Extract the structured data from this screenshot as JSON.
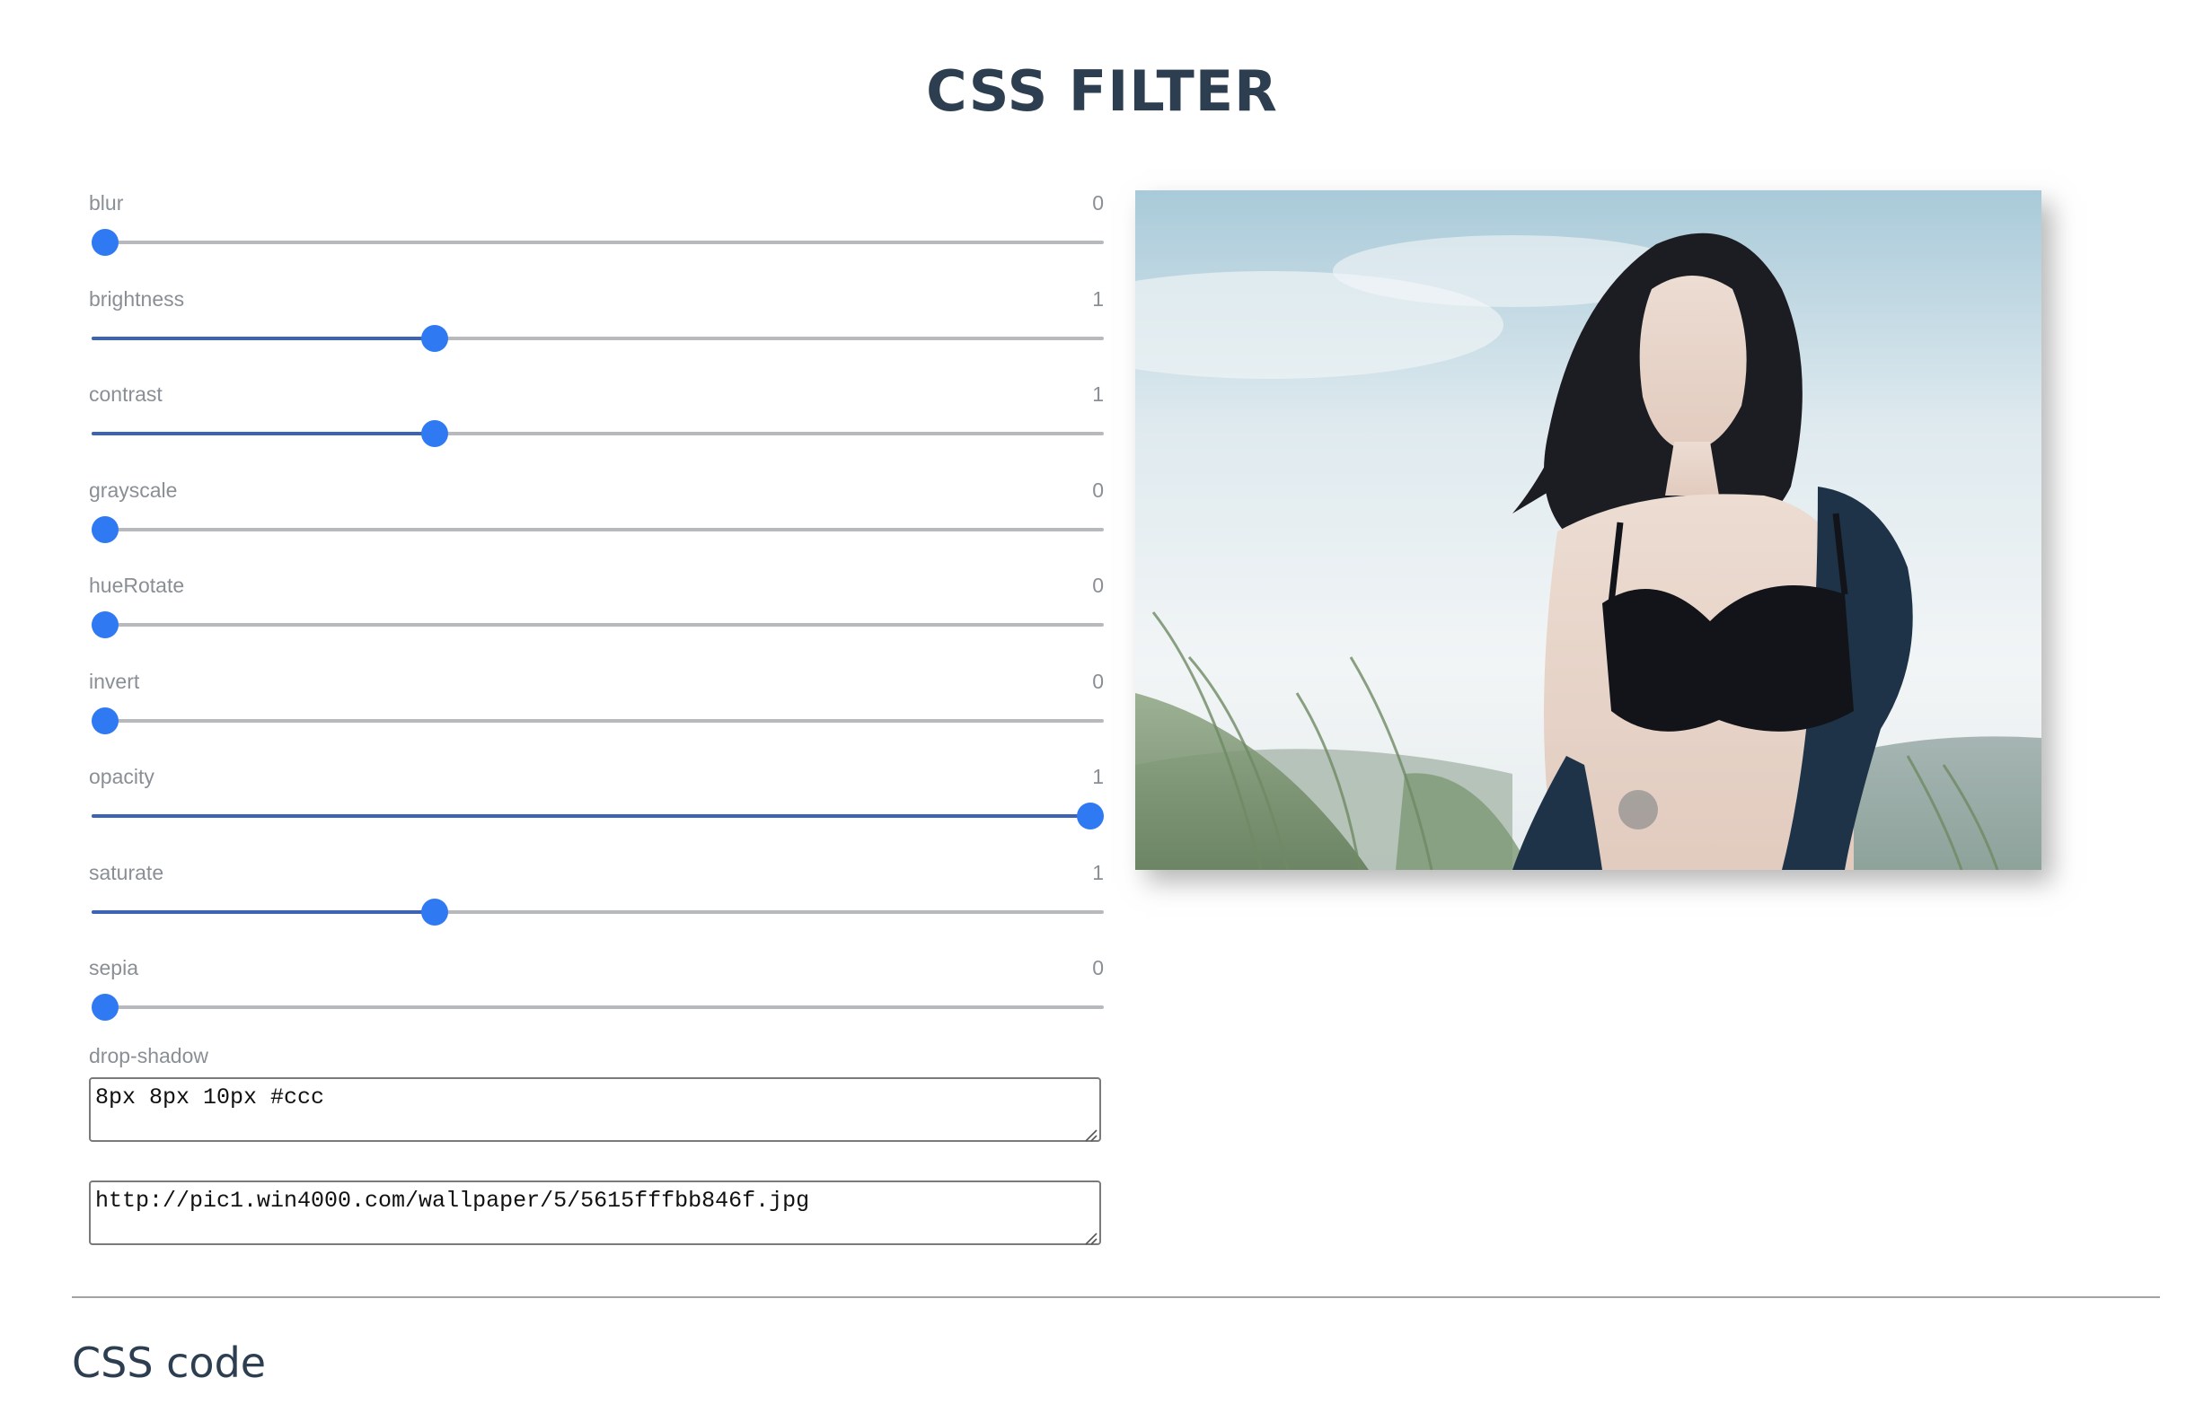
{
  "page": {
    "title": "CSS FILTER",
    "code_heading": "CSS code"
  },
  "sliders": [
    {
      "label": "blur",
      "value": "0",
      "fraction": 0.0
    },
    {
      "label": "brightness",
      "value": "1",
      "fraction": 0.335
    },
    {
      "label": "contrast",
      "value": "1",
      "fraction": 0.335
    },
    {
      "label": "grayscale",
      "value": "0",
      "fraction": 0.0
    },
    {
      "label": "hueRotate",
      "value": "0",
      "fraction": 0.0
    },
    {
      "label": "invert",
      "value": "0",
      "fraction": 0.0
    },
    {
      "label": "opacity",
      "value": "1",
      "fraction": 1.0
    },
    {
      "label": "saturate",
      "value": "1",
      "fraction": 0.335
    },
    {
      "label": "sepia",
      "value": "0",
      "fraction": 0.0
    }
  ],
  "drop_shadow": {
    "label": "drop-shadow",
    "value": "8px 8px 10px #ccc"
  },
  "image_url": {
    "value": "http://pic1.win4000.com/wallpaper/5/5615fffbb846f.jpg"
  },
  "colors": {
    "accent": "#2f7af3",
    "fill": "#3d63b5",
    "track": "#b7b9bc",
    "heading": "#2c3e50",
    "label": "#8a8f96"
  }
}
